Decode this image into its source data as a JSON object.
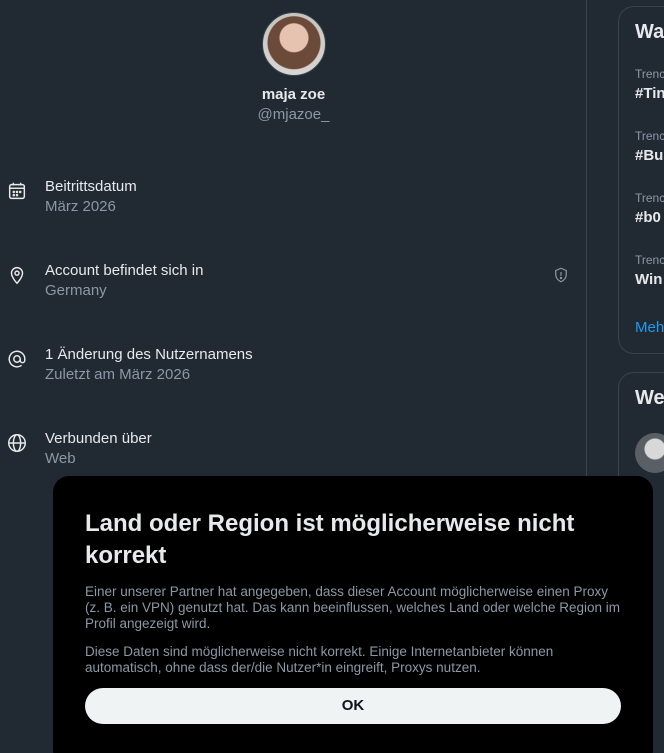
{
  "profile": {
    "name": "maja zoe",
    "handle": "@mjazoe_"
  },
  "info": [
    {
      "icon": "calendar-icon",
      "title": "Beitrittsdatum",
      "sub": "März 2026"
    },
    {
      "icon": "location-pin-icon",
      "title": "Account befindet sich in",
      "sub": "Germany"
    },
    {
      "icon": "at-sign-icon",
      "title": "1 Änderung des Nutzernamens",
      "sub": "Zuletzt am März 2026"
    },
    {
      "icon": "globe-icon",
      "title": "Verbunden über",
      "sub": "Web"
    }
  ],
  "sidebar": {
    "trends_title": "Wa",
    "trends": [
      {
        "cat": "Trenc",
        "tag": "#Tin"
      },
      {
        "cat": "Trenc",
        "tag": "#Bu"
      },
      {
        "cat": "Trenc",
        "tag": "#b0"
      },
      {
        "cat": "Trenc",
        "tag": "Win"
      }
    ],
    "more": "Meh",
    "follow_title": "We"
  },
  "modal": {
    "title": "Land oder Region ist möglicherweise nicht korrekt",
    "p1": "Einer unserer Partner hat angegeben, dass dieser Account möglicherweise einen Proxy (z. B. ein VPN) genutzt hat. Das kann beeinflussen, welches Land oder welche Region im Profil angezeigt wird.",
    "p2": "Diese Daten sind möglicherweise nicht korrekt. Einige Internetanbieter können automatisch, ohne dass der/die Nutzer*in eingreift, Proxys nutzen.",
    "ok_label": "OK"
  },
  "colors": {
    "background": "#212a33",
    "modal_bg": "#000000",
    "secondary_text": "#8b98a5",
    "accent": "#1d9bf0"
  }
}
